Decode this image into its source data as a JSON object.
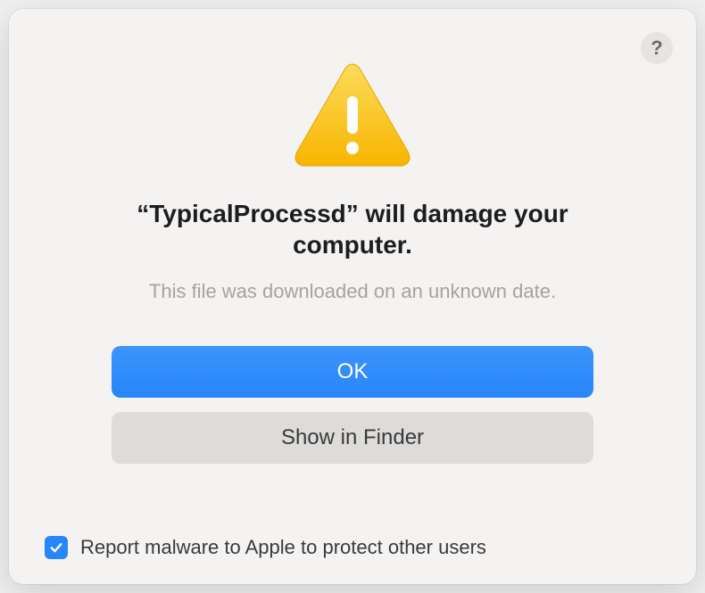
{
  "dialog": {
    "title": "“TypicalProcessd” will damage your computer.",
    "subtitle": "This file was downloaded on an unknown date.",
    "help_label": "?",
    "buttons": {
      "ok": "OK",
      "show_in_finder": "Show in Finder"
    },
    "checkbox": {
      "checked": true,
      "label": "Report malware to Apple to protect other users"
    }
  }
}
